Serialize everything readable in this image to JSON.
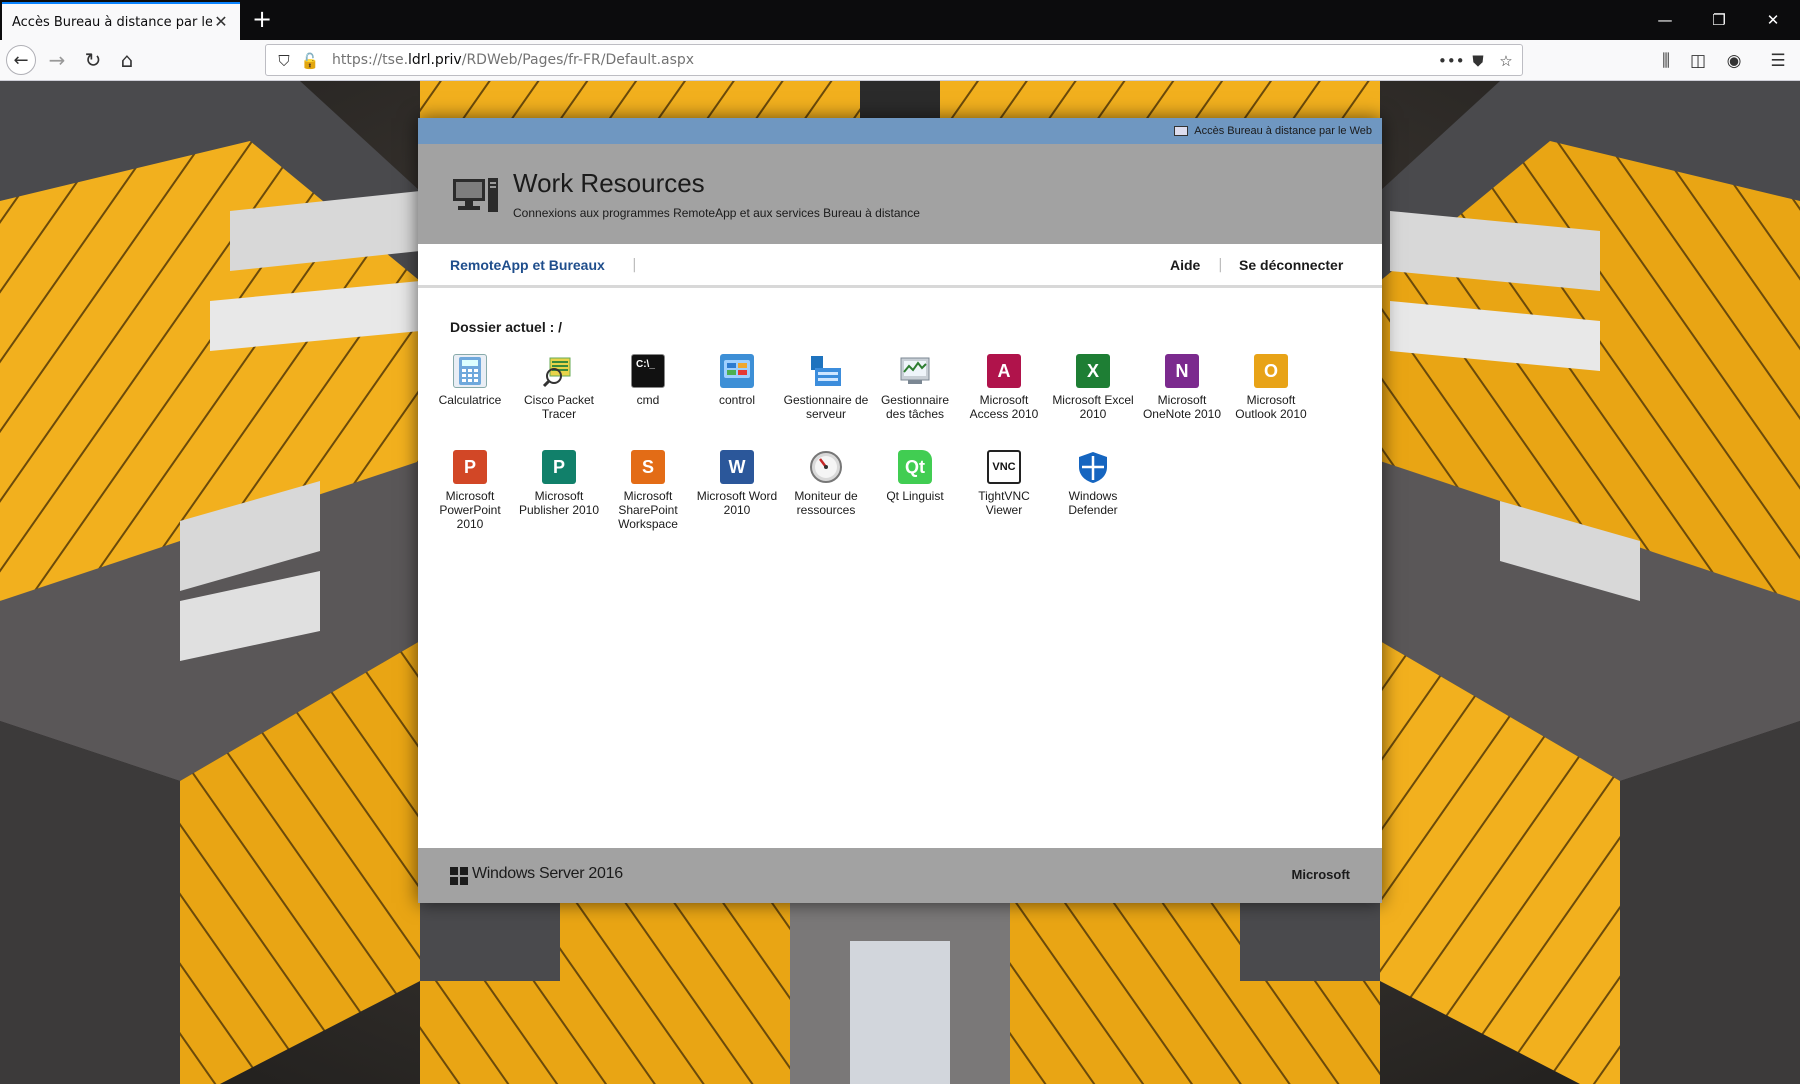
{
  "browser": {
    "tab_title": "Accès Bureau à distance par le Web",
    "url_prefix": "https://tse.",
    "url_domain": "ldrl.priv",
    "url_path": "/RDWeb/Pages/fr-FR/Default.aspx"
  },
  "rdweb": {
    "top_strip_label": "Accès Bureau à distance par le Web",
    "title": "Work Resources",
    "subtitle": "Connexions aux programmes RemoteApp et aux services Bureau à distance",
    "nav_tab": "RemoteApp et Bureaux",
    "help_link": "Aide",
    "logout_link": "Se déconnecter",
    "current_folder": "Dossier actuel : /",
    "footer_os": "Windows Server 2016",
    "footer_brand": "Microsoft",
    "apps": [
      {
        "label": "Calculatrice",
        "icon": "calculator-icon"
      },
      {
        "label": "Cisco Packet Tracer",
        "icon": "packet-tracer-icon"
      },
      {
        "label": "cmd",
        "icon": "cmd-icon"
      },
      {
        "label": "control",
        "icon": "control-panel-icon"
      },
      {
        "label": "Gestionnaire de serveur",
        "icon": "server-manager-icon"
      },
      {
        "label": "Gestionnaire des tâches",
        "icon": "task-manager-icon"
      },
      {
        "label": "Microsoft Access 2010",
        "icon": "access-icon"
      },
      {
        "label": "Microsoft Excel 2010",
        "icon": "excel-icon"
      },
      {
        "label": "Microsoft OneNote 2010",
        "icon": "onenote-icon"
      },
      {
        "label": "Microsoft Outlook 2010",
        "icon": "outlook-icon"
      },
      {
        "label": "Microsoft PowerPoint 2010",
        "icon": "powerpoint-icon"
      },
      {
        "label": "Microsoft Publisher 2010",
        "icon": "publisher-icon"
      },
      {
        "label": "Microsoft SharePoint Workspace",
        "icon": "sharepoint-workspace-icon"
      },
      {
        "label": "Microsoft Word 2010",
        "icon": "word-icon"
      },
      {
        "label": "Moniteur de ressources",
        "icon": "resource-monitor-icon"
      },
      {
        "label": "Qt Linguist",
        "icon": "qt-linguist-icon"
      },
      {
        "label": "TightVNC Viewer",
        "icon": "tightvnc-icon"
      },
      {
        "label": "Windows Defender",
        "icon": "windows-defender-icon"
      }
    ]
  }
}
